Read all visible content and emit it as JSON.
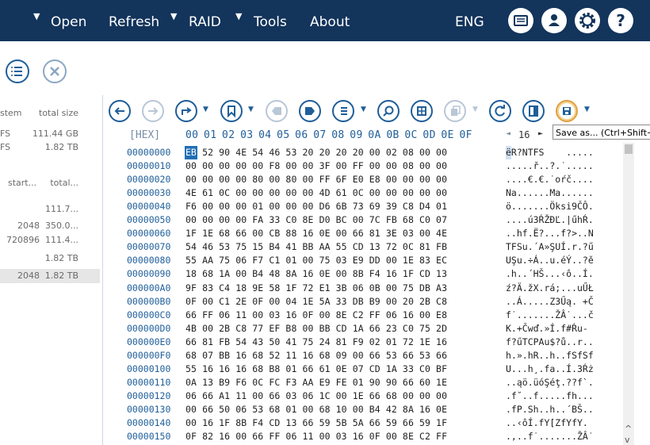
{
  "menu": {
    "open": "Open",
    "refresh": "Refresh",
    "raid": "RAID",
    "tools": "Tools",
    "about": "About",
    "lang": "ENG",
    "arrow": "▼"
  },
  "left_table": {
    "header1": {
      "col1": "stem",
      "col2": "total size"
    },
    "rows1": [
      {
        "col1": "FS",
        "col2": "111.44 GB"
      },
      {
        "col1": "FS",
        "col2": "1.82 TB"
      }
    ],
    "header2": {
      "col1": "start...",
      "col2": "total..."
    },
    "rows2": [
      {
        "col1": "",
        "col2": "111.7..."
      },
      {
        "col1": "2048",
        "col2": "350.0..."
      },
      {
        "col1": "720896",
        "col2": "111.4..."
      },
      {
        "col1": "",
        "col2": "1.82 TB"
      },
      {
        "col1": "2048",
        "col2": "1.82 TB"
      }
    ]
  },
  "hex": {
    "label": "[HEX]",
    "columns": "00 01 02 03 04 05 06 07 08 09 0A 0B 0C 0D 0E 0F",
    "page_number": "16",
    "prev_arrow": "◄",
    "next_arrow": "►",
    "rows": [
      {
        "addr": "00000000",
        "bytes": "   52 90 4E 54 46 53 20 20 20 20 00 02 08 00 00",
        "ascii": " R?NTFS    ....."
      },
      {
        "addr": "00000010",
        "bytes": "00 00 00 00 00 F8 00 00 3F 00 FF 00 00 08 00 00",
        "ascii": ".....ř..?.˙....."
      },
      {
        "addr": "00000020",
        "bytes": "00 00 00 00 80 00 80 00 FF 6F E0 E8 00 00 00 00",
        "ascii": "....€.€.˙oŕč...."
      },
      {
        "addr": "00000030",
        "bytes": "4E 61 0C 00 00 00 00 00 4D 61 0C 00 00 00 00 00",
        "ascii": "Na......Ma......"
      },
      {
        "addr": "00000040",
        "bytes": "F6 00 00 00 01 00 00 00 D6 6B 73 69 39 C8 D4 01",
        "ascii": "ö.......Öksi9ČÔ."
      },
      {
        "addr": "00000050",
        "bytes": "00 00 00 00 FA 33 C0 8E D0 BC 00 7C FB 68 C0 07",
        "ascii": "....ú3ŔŽĐĽ.|űhŔ."
      },
      {
        "addr": "00000060",
        "bytes": "1F 1E 68 66 00 CB 88 16 0E 00 66 81 3E 03 00 4E",
        "ascii": "..hf.Ë?...f?>..N"
      },
      {
        "addr": "00000070",
        "bytes": "54 46 53 75 15 B4 41 BB AA 55 CD 13 72 0C 81 FB",
        "ascii": "TFSu.´A»ŞUÍ.r.?ű"
      },
      {
        "addr": "00000080",
        "bytes": "55 AA 75 06 F7 C1 01 00 75 03 E9 DD 00 1E 83 EC",
        "ascii": "UŞu.÷Á..u.éÝ..?ě"
      },
      {
        "addr": "00000090",
        "bytes": "18 68 1A 00 B4 48 8A 16 0E 00 8B F4 16 1F CD 13",
        "ascii": ".h..´HŠ...‹ô..Í."
      },
      {
        "addr": "000000A0",
        "bytes": "9F 83 C4 18 9E 58 1F 72 E1 3B 06 0B 00 75 DB A3",
        "ascii": "ź?Ä.žX.rá;...uŰŁ"
      },
      {
        "addr": "000000B0",
        "bytes": "0F 00 C1 2E 0F 00 04 1E 5A 33 DB B9 00 20 2B C8",
        "ascii": "..Á.....Z3Űą. +Č"
      },
      {
        "addr": "000000C0",
        "bytes": "66 FF 06 11 00 03 16 0F 00 8E C2 FF 06 16 00 E8",
        "ascii": "f˙.......ŽÂ˙...č"
      },
      {
        "addr": "000000D0",
        "bytes": "4B 00 2B C8 77 EF B8 00 BB CD 1A 66 23 C0 75 2D",
        "ascii": "K.+Čwď.»Í.f#Ŕu-"
      },
      {
        "addr": "000000E0",
        "bytes": "66 81 FB 54 43 50 41 75 24 81 F9 02 01 72 1E 16",
        "ascii": "f?űTCPAu$?ů..r.."
      },
      {
        "addr": "000000F0",
        "bytes": "68 07 BB 16 68 52 11 16 68 09 00 66 53 66 53 66",
        "ascii": "h.».hR..h..fSfSf"
      },
      {
        "addr": "00000100",
        "bytes": "55 16 16 16 68 B8 01 66 61 0E 07 CD 1A 33 C0 BF",
        "ascii": "U...h¸.fa..Í.3Ŕż"
      },
      {
        "addr": "00000110",
        "bytes": "0A 13 B9 F6 0C FC F3 AA E9 FE 01 90 90 66 60 1E",
        "ascii": "..ąö.üóŞéţ.??f`."
      },
      {
        "addr": "00000120",
        "bytes": "06 66 A1 11 00 66 03 06 1C 00 1E 66 68 00 00 00",
        "ascii": ".f˘..f.....fh..."
      },
      {
        "addr": "00000130",
        "bytes": "00 66 50 06 53 68 01 00 68 10 00 B4 42 8A 16 0E",
        "ascii": ".fP.Sh..h..´BŠ.."
      },
      {
        "addr": "00000140",
        "bytes": "00 16 1F 8B F4 CD 13 66 59 5B 5A 66 59 66 59 1F",
        "ascii": "..‹ôÍ.fY[ZfYfY."
      },
      {
        "addr": "00000150",
        "bytes": "0F 82 16 00 66 FF 06 11 00 03 16 0F 00 8E C2 FF",
        "ascii": ".‚..f˙.......ŽÂ˙"
      }
    ],
    "first_byte": "EB",
    "first_ascii": "ë"
  },
  "tooltip": "Save as... (Ctrl+Shift+S)",
  "colors": {
    "topbar": "#13345b",
    "accent": "#1f5e9a",
    "save_ring": "#e0a040"
  }
}
